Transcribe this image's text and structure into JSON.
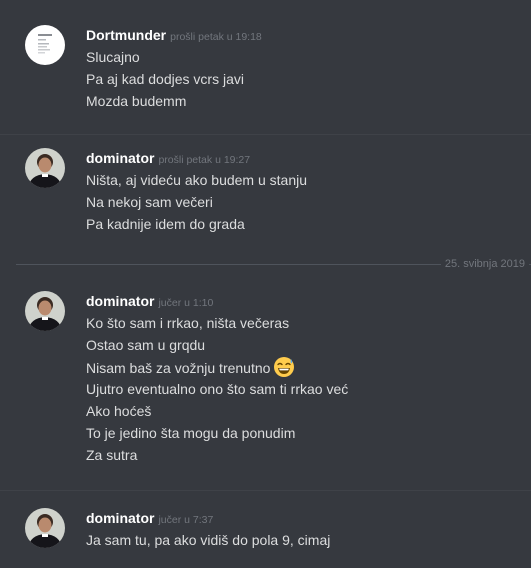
{
  "colors": {
    "background": "#36393f",
    "username": "#ffffff",
    "timestamp": "#72767d",
    "message_text": "#dcddde",
    "divider": "#4f545c"
  },
  "groups": [
    {
      "username": "Dortmunder",
      "timestamp": "prošli petak u 19:18",
      "avatar_icon": "document-avatar-icon",
      "messages": [
        "Slucajno",
        "Pa aj kad dodjes vcrs javi",
        "Mozda budemm"
      ]
    },
    {
      "username": "dominator",
      "timestamp": "prošli petak u 19:27",
      "avatar_icon": "priest-avatar-icon",
      "messages": [
        "Ništa, aj videću ako budem u stanju",
        "Na nekoj sam večeri",
        "Pa kadnije idem do grada"
      ]
    },
    {
      "username": "dominator",
      "timestamp": "jučer u 1:10",
      "avatar_icon": "priest-avatar-icon",
      "messages": [
        "Ko što sam i rrkao, ništa večeras",
        "Ostao sam u grqdu",
        "Nisam baš za vožnju trenutno",
        "Ujutro eventualno ono što sam ti rrkao već",
        "Ako hoćeš",
        "To je jedino šta mogu da ponudim",
        "Za sutra"
      ],
      "emoji_icon": "grinning-sweat-emoji-icon"
    },
    {
      "username": "dominator",
      "timestamp": "jučer u 7:37",
      "avatar_icon": "priest-avatar-icon",
      "messages": [
        "Ja sam tu, pa ako vidiš do pola 9, cimaj"
      ]
    }
  ],
  "date_divider": "25. svibnja 2019"
}
